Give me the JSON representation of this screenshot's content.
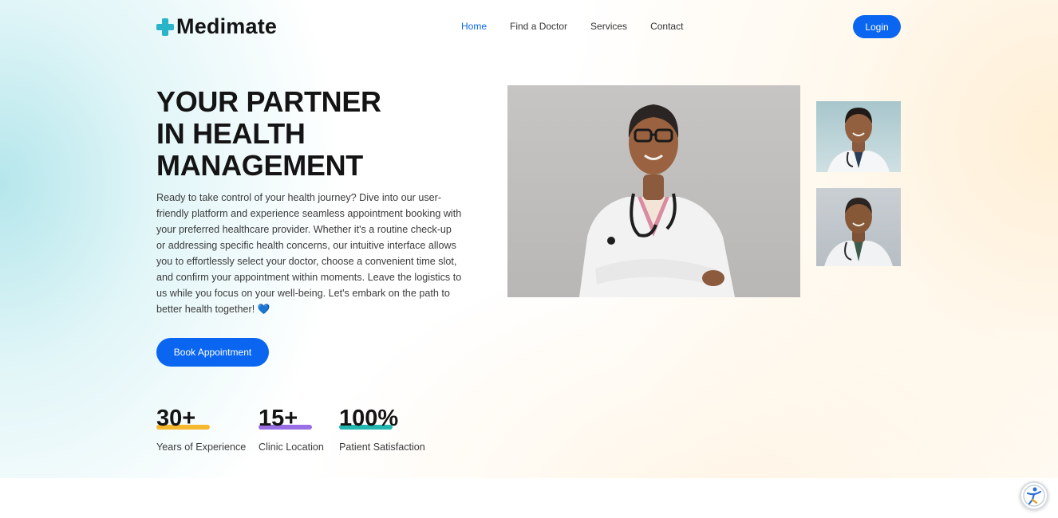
{
  "brand": {
    "name": "Medimate"
  },
  "nav": {
    "items": [
      {
        "label": "Home",
        "active": true
      },
      {
        "label": "Find a Doctor",
        "active": false
      },
      {
        "label": "Services",
        "active": false
      },
      {
        "label": "Contact",
        "active": false
      }
    ],
    "login_label": "Login"
  },
  "hero": {
    "headline_lines": [
      "YOUR PARTNER",
      "IN HEALTH",
      "MANAGEMENT"
    ],
    "description": "Ready to take control of your health journey? Dive into our user-friendly platform and experience seamless appointment booking with your preferred healthcare provider. Whether it's a routine check-up or addressing specific health concerns, our intuitive interface allows you to effortlessly select your doctor, choose a convenient time slot, and confirm your appointment within moments. Leave the logistics to us while you focus on your well-being. Let's embark on the path to better health together!",
    "heart_emoji": "💙",
    "cta_label": "Book Appointment"
  },
  "stats": [
    {
      "value": "30+",
      "label": "Years of Experience",
      "color": "#f5b82e"
    },
    {
      "value": "15+",
      "label": "Clinic Location",
      "color": "#9a6fe6"
    },
    {
      "value": "100%",
      "label": "Patient Satisfaction",
      "color": "#22b7b0"
    }
  ],
  "colors": {
    "primary": "#0a66f0",
    "logo_cross": "#2ab4c9",
    "heading": "#141414"
  },
  "images": {
    "main": "doctor-woman-photo",
    "side": [
      "doctor-man-photo",
      "doctor-senior-man-photo"
    ]
  }
}
